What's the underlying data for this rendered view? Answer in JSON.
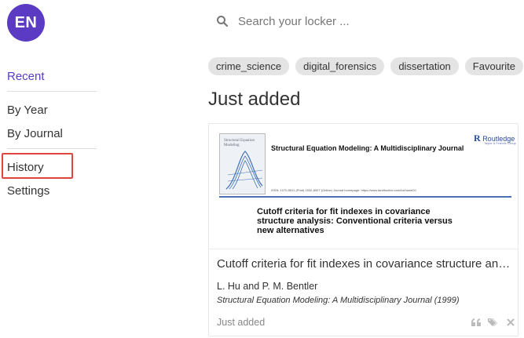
{
  "user": {
    "initials": "EN"
  },
  "sidebar": {
    "items": [
      {
        "label": "Recent"
      },
      {
        "label": "By Year"
      },
      {
        "label": "By Journal"
      },
      {
        "label": "History"
      },
      {
        "label": "Settings"
      }
    ]
  },
  "search": {
    "placeholder": "Search your locker ..."
  },
  "tags": [
    "crime_science",
    "digital_forensics",
    "dissertation",
    "Favourite"
  ],
  "section": {
    "title": "Just added"
  },
  "card": {
    "thumbnail": {
      "cover_title": "Structural Equation Modeling",
      "journal": "Structural Equation Modeling: A Multidisciplinary Journal",
      "publisher": "Routledge",
      "publisher_sub": "Taylor & Francis Group",
      "issn": "ISSN: 1070-5511 (Print) 1532-8007 (Online) Journal homepage: https://www.tandfonline.com/loi/hsem20",
      "article_title": "Cutoff criteria for fit indexes in covariance structure analysis: Conventional criteria versus new alternatives"
    },
    "title": "Cutoff criteria for fit indexes in covariance structure analysis: Conventional criteria versus new alternatives",
    "authors": "L. Hu and P. M. Bentler",
    "journal": "Structural Equation Modeling: A Multidisciplinary Journal (1999)",
    "status": "Just added",
    "actions": [
      "quote-icon",
      "tags-icon",
      "close-icon"
    ]
  },
  "colors": {
    "accent": "#5b3bc4",
    "highlight": "#e0443a",
    "tag_bg": "#e4e4e4"
  }
}
